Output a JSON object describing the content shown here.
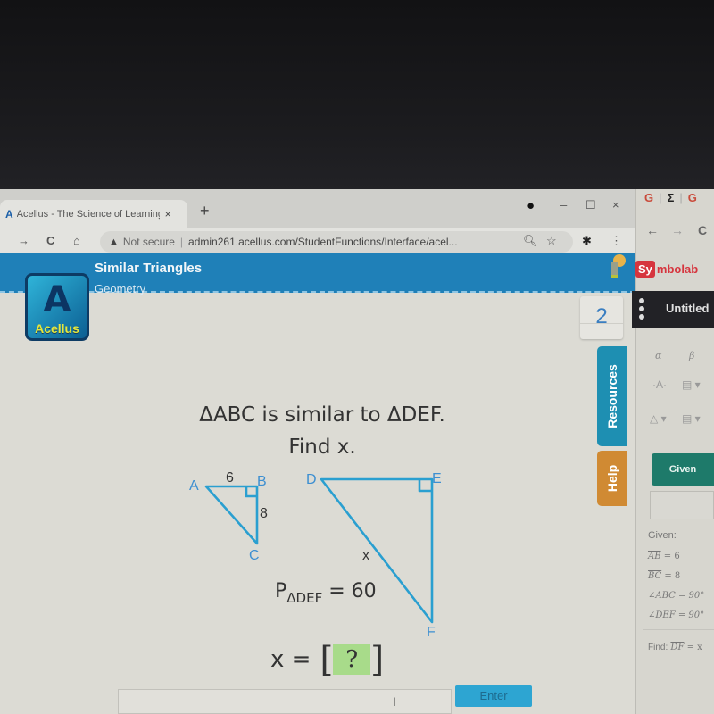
{
  "browser": {
    "tab_title": "Acellus - The Science of Learning",
    "tab_close": "×",
    "new_tab": "+",
    "window_controls": {
      "profile": "●",
      "minimize": "–",
      "maximize": "☐",
      "close": "×"
    },
    "nav": {
      "back": "←",
      "forward": "→",
      "reload": "C",
      "home": "⌂"
    },
    "security_icon": "▲",
    "security_label": "Not secure",
    "url": "admin261.acellus.com/StudentFunctions/Interface/acel...",
    "omnibox_icons": {
      "zoom": "🔍︎",
      "bookmark": "☆",
      "extensions": "✱",
      "menu": "⋮"
    }
  },
  "acellus": {
    "logo_word": "Acellus",
    "logo_mark": "A",
    "lesson_title": "Similar Triangles",
    "course": "Geometry",
    "problem_counter": "2",
    "side_tabs": {
      "resources": "Resources",
      "help": "Help"
    },
    "question_line1": "ΔABC is similar to ΔDEF.",
    "question_line2": "Find x.",
    "figure": {
      "small_triangle": {
        "vertices": [
          "A",
          "B",
          "C"
        ],
        "side_AB": "6",
        "side_BC": "8",
        "right_angle_at": "B"
      },
      "large_triangle": {
        "vertices": [
          "D",
          "E",
          "F"
        ],
        "side_DF": "x",
        "right_angle_at": "E"
      }
    },
    "perimeter_label": "P",
    "perimeter_sub": "ΔDEF",
    "perimeter_value": "= 60",
    "answer_label": "x =",
    "answer_placeholder": "?",
    "input_value": "",
    "enter_button": "Enter"
  },
  "colors": {
    "banner": "#1f80b8",
    "figure_stroke": "#2a9fd0",
    "vertex_label": "#3d8fd1",
    "answer_box": "#a8db8a",
    "enter_button": "#2da5d2",
    "resources_tab": "#1e8fb2",
    "help_tab": "#d08a33",
    "symbolab_red": "#d6353e",
    "given_button": "#1e7a6a"
  },
  "symbolab": {
    "top_tabs": [
      "G",
      "Σ",
      "G"
    ],
    "nav": {
      "back": "←",
      "forward": "→",
      "reload": "C"
    },
    "logo_sy": "Sy",
    "logo_rest": "mbolab",
    "notebook_title": "Untitled",
    "keypad": {
      "alpha": "α",
      "beta": "β",
      "row2a": "·A·",
      "row2b": "▤ ▾",
      "row3a": "△ ▾",
      "row3b": "▤ ▾"
    },
    "given_button": "Given",
    "given_heading": "Given:",
    "given_items": [
      {
        "lhs": "AB",
        "rhs": "= 6",
        "overline": true
      },
      {
        "lhs": "BC",
        "rhs": "= 8",
        "overline": true
      },
      {
        "lhs": "∠ABC",
        "rhs": "= 90°",
        "overline": false
      },
      {
        "lhs": "∠DEF",
        "rhs": "= 90°",
        "overline": false
      }
    ],
    "find_label": "Find:",
    "find_lhs": "DF",
    "find_rhs": "= x"
  }
}
